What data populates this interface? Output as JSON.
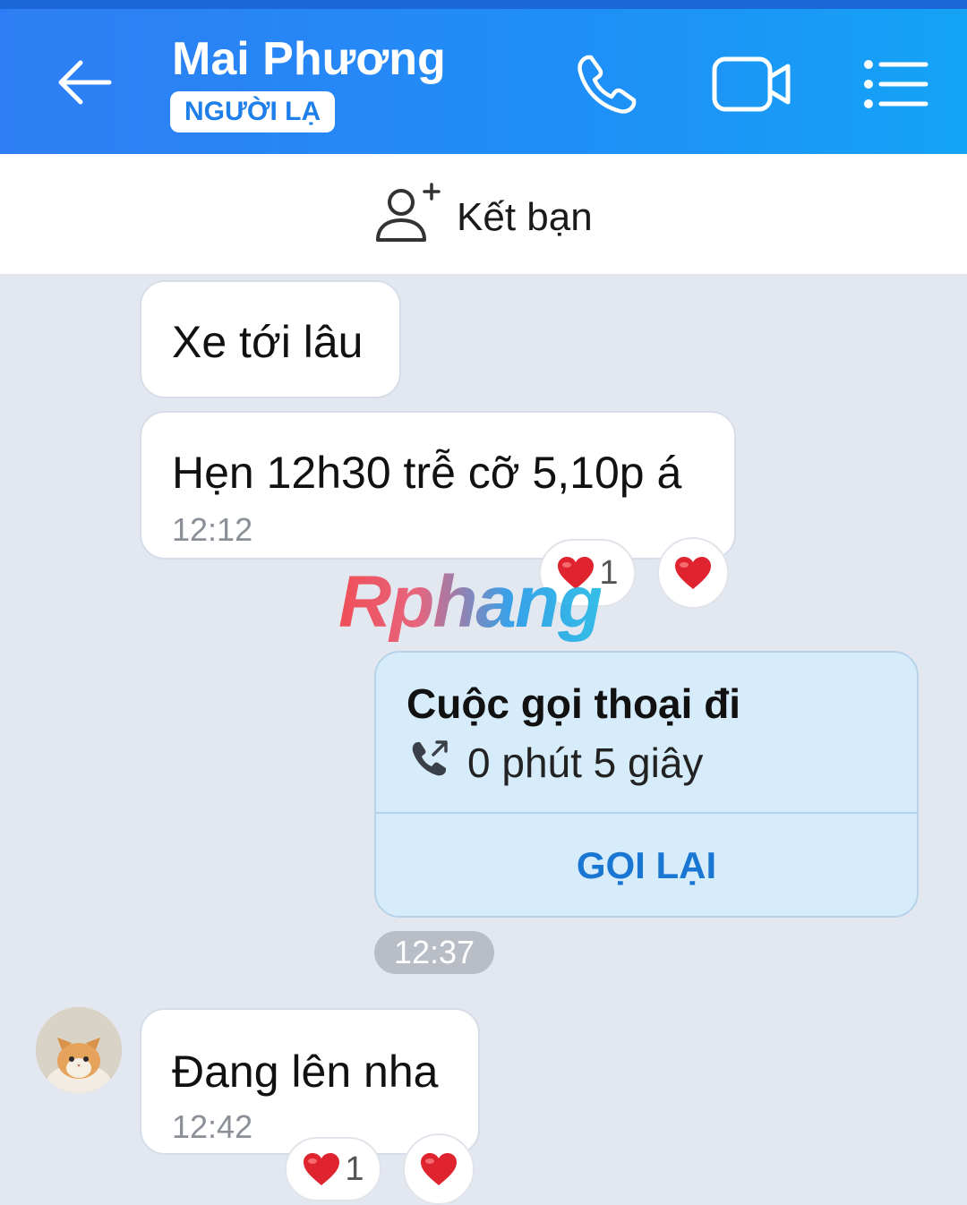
{
  "header": {
    "contact_name": "Mai Phương",
    "stranger_badge": "NGƯỜI LẠ",
    "icons": {
      "back": "back-arrow-icon",
      "call": "phone-icon",
      "video": "video-camera-icon",
      "menu": "list-menu-icon"
    }
  },
  "friend_bar": {
    "label": "Kết bạn",
    "icon": "add-person-icon"
  },
  "messages": [
    {
      "text": "Xe tới lâu"
    },
    {
      "text": "Hẹn 12h30 trễ cỡ 5,10p á",
      "time": "12:12",
      "reaction_count": "1"
    }
  ],
  "watermark": "Rphang",
  "call_card": {
    "title": "Cuộc gọi thoại đi",
    "duration": "0 phút 5 giây",
    "callback_label": "GỌI LẠI",
    "icon": "outgoing-call-icon"
  },
  "time_separator": "12:37",
  "last_message": {
    "text": "Đang lên nha",
    "time": "12:42",
    "reaction_count": "1"
  },
  "colors": {
    "header_start": "#2f7df4",
    "header_end": "#14a3f5",
    "accent": "#1976d2",
    "background": "#e3e8f0",
    "heart": "#e0242f"
  }
}
